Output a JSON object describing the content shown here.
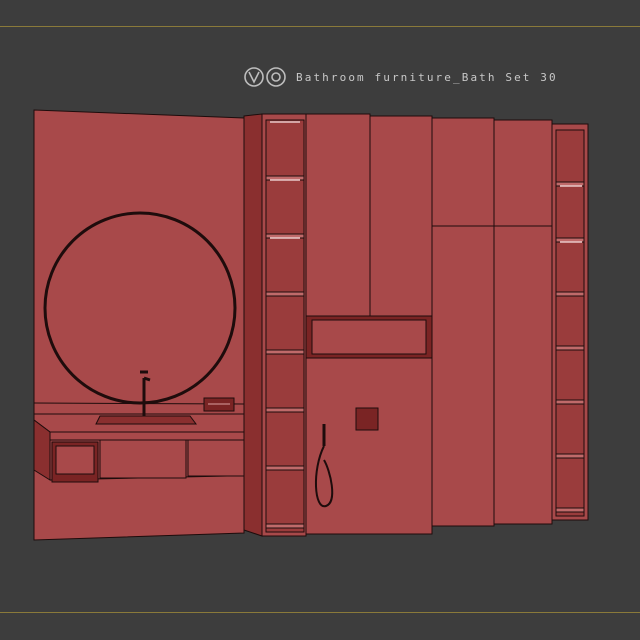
{
  "render": {
    "title": "Bathroom furniture_Bath Set 30",
    "logo_icons": [
      "v-ray-logo-icon",
      "corona-logo-icon"
    ]
  },
  "colors": {
    "background": "#3d3d3d",
    "frame_line": "#8a7a3a",
    "wall_fill": "#a8494a",
    "wire_stroke": "#1e0c0c",
    "shadow_fill": "#8a2f2f",
    "dark_fill": "#7a2424"
  }
}
